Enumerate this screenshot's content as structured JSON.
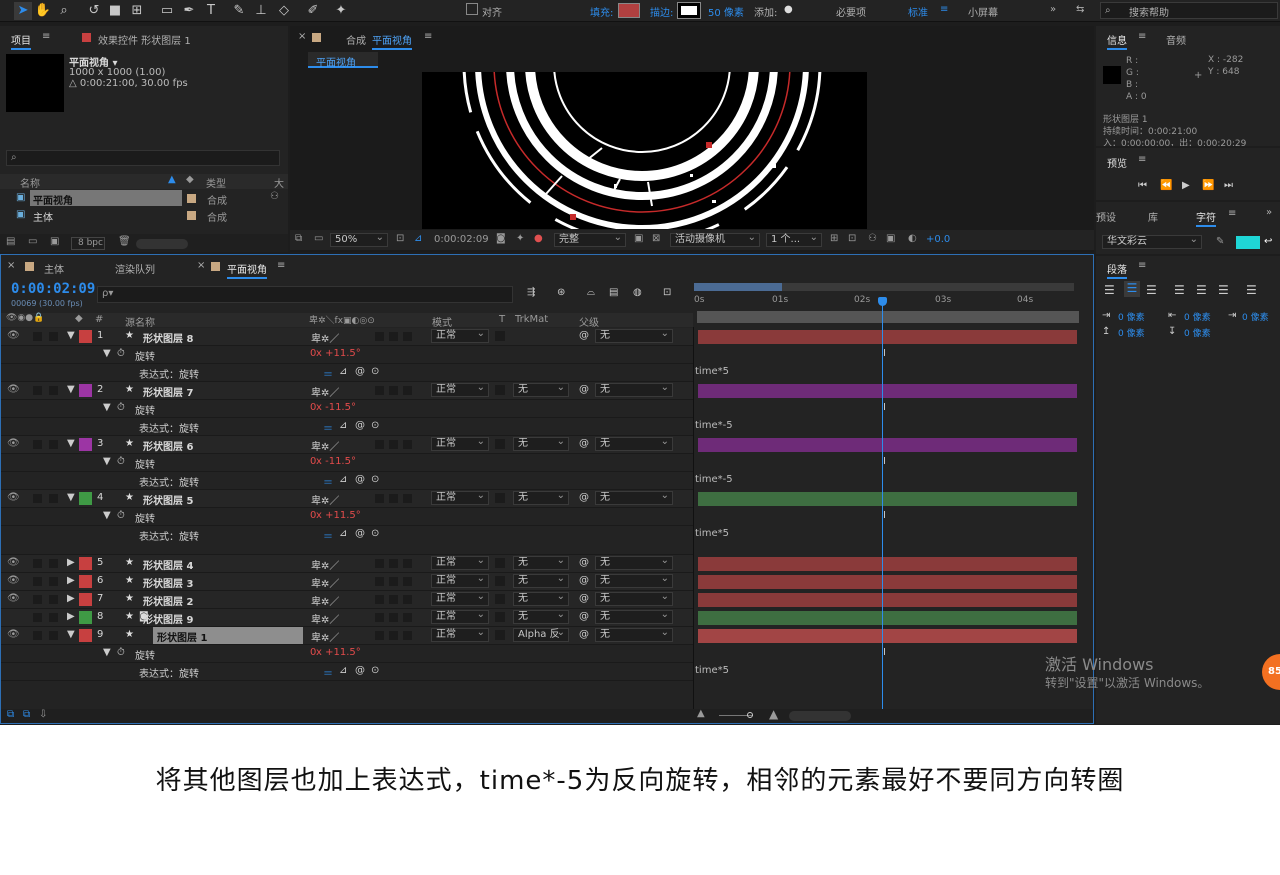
{
  "toolbar": {
    "snap_label": "对齐",
    "fill_label": "填充:",
    "stroke_label": "描边:",
    "stroke_value": "50 像素",
    "add_label": "添加:",
    "workspaces": [
      "必要项",
      "标准",
      "小屏幕"
    ],
    "search_placeholder": "搜索帮助"
  },
  "project": {
    "tab_project": "项目",
    "tab_effects": "效果控件 形状图层 1",
    "comp_name": "平面视角 ▾",
    "comp_size": "1000 x 1000 (1.00)",
    "comp_duration": "△ 0:00:21:00, 30.00 fps",
    "col_name": "名称",
    "col_type": "类型",
    "col_extra": "大",
    "items": [
      {
        "name": "平面视角",
        "type": "合成"
      },
      {
        "name": "主体",
        "type": "合成"
      }
    ],
    "bpc": "8 bpc"
  },
  "composition": {
    "tab_label": "合成",
    "tab_name": "平面视角",
    "sub_tab": "平面视角",
    "zoom": "50%",
    "timecode": "0:00:02:09",
    "quality": "完整",
    "camera": "活动摄像机",
    "views": "1 个...",
    "exposure": "+0.0"
  },
  "info": {
    "tab_info": "信息",
    "tab_audio": "音频",
    "r": "R :",
    "g": "G :",
    "b": "B :",
    "a": "A : 0",
    "x": "X : -282",
    "y": "Y : 648",
    "layer": "形状图层 1",
    "duration": "持续时间：0:00:21:00",
    "inout": "入：0:00:00:00，出：0:00:20:29"
  },
  "preview": {
    "tab": "预览"
  },
  "character": {
    "tab_effects": "预设",
    "tab_library": "库",
    "tab_character": "字符",
    "font": "华文彩云",
    "tab_paragraph": "段落",
    "indent_values": [
      "0 像素",
      "0 像素",
      "0 像素",
      "0 像素",
      "0 像素"
    ]
  },
  "timeline": {
    "tabs": [
      "主体",
      "渲染队列",
      "平面视角"
    ],
    "timecode": "0:00:02:09",
    "frames": "00069 (30.00 fps)",
    "search_placeholder": "ρ▾",
    "col_num": "#",
    "col_source": "源名称",
    "col_mode": "模式",
    "col_t": "T",
    "col_trkmat": "TrkMat",
    "col_parent": "父级",
    "ruler": [
      "0s",
      "01s",
      "02s",
      "03s",
      "04s"
    ],
    "current_time_fraction": 0.497,
    "rows": [
      {
        "kind": "layer",
        "num": "1",
        "name": "形状图层 8",
        "color": "#c74040",
        "mode": "正常",
        "trkmat": "",
        "parent": "无",
        "bar": "#8a3a3a"
      },
      {
        "kind": "prop",
        "label": "旋转",
        "value_a": "0",
        "value_b": "x +11.5°"
      },
      {
        "kind": "expr",
        "label": "表达式：旋转",
        "expr": "time*5"
      },
      {
        "kind": "layer",
        "num": "2",
        "name": "形状图层 7",
        "color": "#9c35a4",
        "mode": "正常",
        "trkmat": "无",
        "parent": "无",
        "bar": "#6e2b78"
      },
      {
        "kind": "prop",
        "label": "旋转",
        "value_a": "0",
        "value_b": "x -11.5°"
      },
      {
        "kind": "expr",
        "label": "表达式：旋转",
        "expr": "time*-5"
      },
      {
        "kind": "layer",
        "num": "3",
        "name": "形状图层 6",
        "color": "#9c35a4",
        "mode": "正常",
        "trkmat": "无",
        "parent": "无",
        "bar": "#6e2b78"
      },
      {
        "kind": "prop",
        "label": "旋转",
        "value_a": "0",
        "value_b": "x -11.5°"
      },
      {
        "kind": "expr",
        "label": "表达式：旋转",
        "expr": "time*-5"
      },
      {
        "kind": "layer",
        "num": "4",
        "name": "形状图层 5",
        "color": "#3f9a45",
        "mode": "正常",
        "trkmat": "无",
        "parent": "无",
        "bar": "#3e6e41"
      },
      {
        "kind": "prop",
        "label": "旋转",
        "value_a": "0",
        "value_b": "x +11.5°"
      },
      {
        "kind": "expr2",
        "label": "表达式：旋转",
        "expr": "time*5"
      },
      {
        "kind": "layer",
        "num": "5",
        "name": "形状图层 4",
        "color": "#c74040",
        "mode": "正常",
        "trkmat": "无",
        "parent": "无",
        "bar": "#8a3a3a",
        "collapsed": true
      },
      {
        "kind": "layer",
        "num": "6",
        "name": "形状图层 3",
        "color": "#c74040",
        "mode": "正常",
        "trkmat": "无",
        "parent": "无",
        "bar": "#8a3a3a",
        "collapsed": true
      },
      {
        "kind": "layer",
        "num": "7",
        "name": "形状图层 2",
        "color": "#c74040",
        "mode": "正常",
        "trkmat": "无",
        "parent": "无",
        "bar": "#8a3a3a",
        "collapsed": true
      },
      {
        "kind": "layer",
        "num": "8",
        "name": "形状图层 9",
        "color": "#3f9a45",
        "mode": "正常",
        "trkmat": "无",
        "parent": "无",
        "bar": "#3e6e41",
        "collapsed": true
      },
      {
        "kind": "layer",
        "num": "9",
        "name": "形状图层 1",
        "color": "#c74040",
        "mode": "正常",
        "trkmat": "Alpha 反",
        "parent": "无",
        "bar": "#a24545",
        "selected": true
      },
      {
        "kind": "prop",
        "label": "旋转",
        "value_a": "0",
        "value_b": "x +11.5°"
      },
      {
        "kind": "expr",
        "label": "表达式：旋转",
        "expr": "time*5"
      }
    ]
  },
  "watermark": {
    "line1": "激活 Windows",
    "line2": "转到\"设置\"以激活 Windows。",
    "badge": "85"
  },
  "caption": "将其他图层也加上表达式，time*-5为反向旋转，相邻的元素最好不要同方向转圈",
  "colors": {
    "accent": "#2d8ceb",
    "fill_swatch": "#b04040",
    "char_color": "#1fd6d6"
  }
}
